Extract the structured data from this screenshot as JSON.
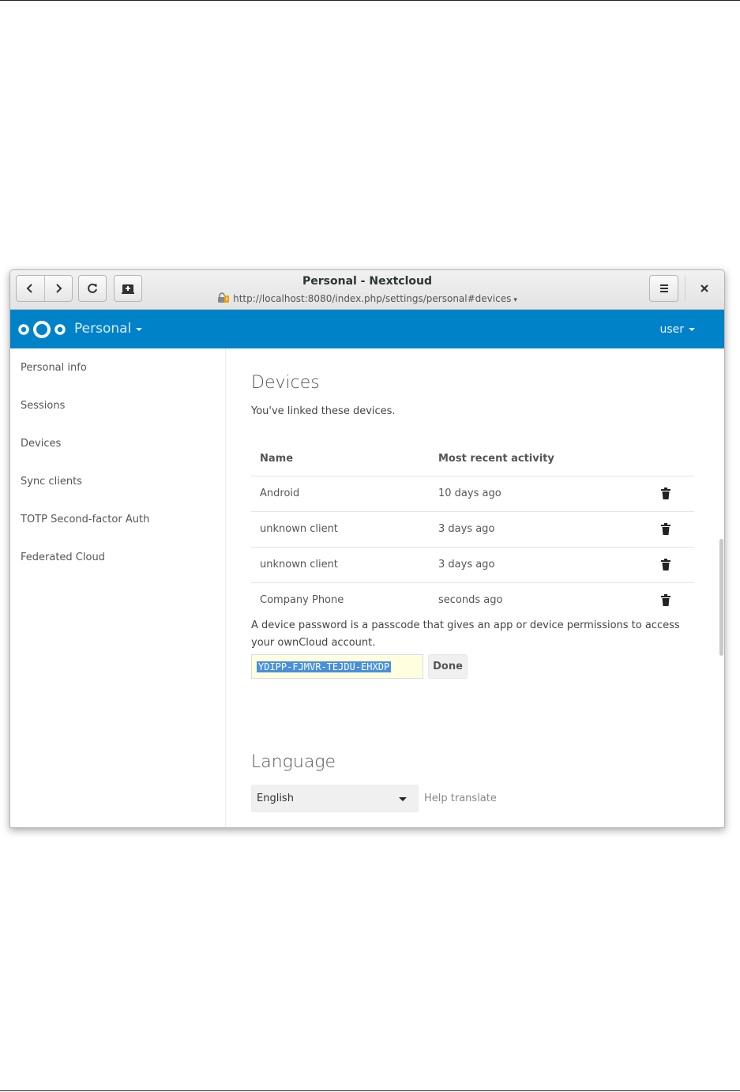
{
  "window": {
    "title": "Personal - Nextcloud",
    "url": "http://localhost:8080/index.php/settings/personal#devices"
  },
  "header": {
    "app_name": "Personal",
    "user": "user",
    "brand_color": "#0082c9"
  },
  "sidebar": {
    "items": [
      {
        "label": "Personal info"
      },
      {
        "label": "Sessions"
      },
      {
        "label": "Devices"
      },
      {
        "label": "Sync clients"
      },
      {
        "label": "TOTP Second-factor Auth"
      },
      {
        "label": "Federated Cloud"
      }
    ]
  },
  "devices": {
    "heading": "Devices",
    "description": "You've linked these devices.",
    "columns": [
      "Name",
      "Most recent activity"
    ],
    "rows": [
      {
        "name": "Android",
        "activity": "10 days ago"
      },
      {
        "name": "unknown client",
        "activity": "3 days ago"
      },
      {
        "name": "unknown client",
        "activity": "3 days ago"
      },
      {
        "name": "Company Phone",
        "activity": "seconds ago"
      }
    ],
    "password_note_line1": "A device password is a passcode that gives an app or device permissions to access",
    "password_note_line2": "your ownCloud account.",
    "generated_password": "YDIPP-FJMVR-TEJDU-EHXDP",
    "done_label": "Done"
  },
  "language": {
    "heading": "Language",
    "selected": "English",
    "help_link": "Help translate"
  },
  "icons": {
    "back": "chevron-left-icon",
    "forward": "chevron-right-icon",
    "reload": "reload-icon",
    "new_tab": "new-tab-icon",
    "menu": "hamburger-icon",
    "close": "close-icon",
    "delete": "trash-icon"
  }
}
